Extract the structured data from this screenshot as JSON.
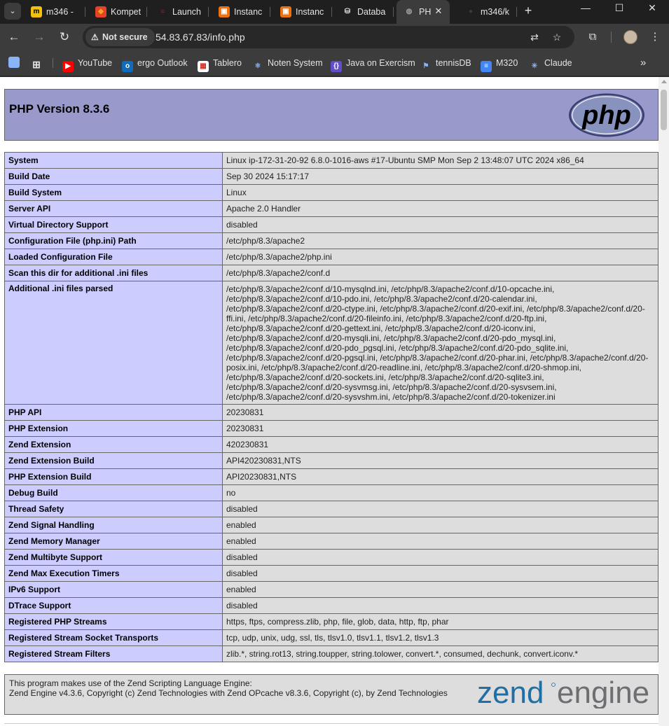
{
  "tabs": [
    {
      "label": "m346 -",
      "fav_color": "#f4c20d",
      "fav_text": "m",
      "fav_text_color": "#000"
    },
    {
      "label": "Kompet",
      "fav_color": "#e24329",
      "fav_text": "◆",
      "fav_text_color": "#fca326"
    },
    {
      "label": "Launch",
      "fav_color": "#1f1f1f",
      "fav_text": "○",
      "fav_text_color": "#e03030"
    },
    {
      "label": "Instanc",
      "fav_color": "#ec7211",
      "fav_text": "▣",
      "fav_text_color": "#fff"
    },
    {
      "label": "Instanc",
      "fav_color": "#ec7211",
      "fav_text": "▣",
      "fav_text_color": "#fff"
    },
    {
      "label": "Databa",
      "fav_color": "#1f1f1f",
      "fav_text": "⛁",
      "fav_text_color": "#e3e3e3"
    },
    {
      "label": "PH",
      "fav_color": "#3c3c3c",
      "fav_text": "◍",
      "fav_text_color": "#9aa0a6",
      "active": true
    },
    {
      "label": "m346/k",
      "fav_color": "#1f1f1f",
      "fav_text": "●",
      "fav_text_color": "#3a3a3a"
    }
  ],
  "window_controls": {
    "minimize": "—",
    "maximize": "☐",
    "close": "✕"
  },
  "toolbar": {
    "security_label": "Not secure",
    "url": "54.83.67.83/info.php"
  },
  "bookmarks": [
    {
      "label": "YouTube",
      "fav_color": "#ff0000",
      "fav_text": "▶"
    },
    {
      "label": "ergo Outlook",
      "fav_color": "#0f6cbd",
      "fav_text": "o"
    },
    {
      "label": "Tablero",
      "fav_color": "#ffffff",
      "fav_text": "▦"
    },
    {
      "label": "Noten System",
      "fav_color": "#3c3c3c",
      "fav_text": "⚛"
    },
    {
      "label": "Java on Exercism",
      "fav_color": "#604fcd",
      "fav_text": "{}"
    },
    {
      "label": "tennisDB",
      "fav_color": "#3c3c3c",
      "fav_text": "⚑"
    },
    {
      "label": "M320",
      "fav_color": "#4285f4",
      "fav_text": "≡"
    },
    {
      "label": "Claude",
      "fav_color": "#3c3c3c",
      "fav_text": "✳"
    }
  ],
  "page": {
    "title": "PHP Version 8.3.6",
    "logo_text": "php",
    "rows": [
      {
        "key": "System",
        "value": "Linux ip-172-31-20-92 6.8.0-1016-aws #17-Ubuntu SMP Mon Sep 2 13:48:07 UTC 2024 x86_64"
      },
      {
        "key": "Build Date",
        "value": "Sep 30 2024 15:17:17"
      },
      {
        "key": "Build System",
        "value": "Linux"
      },
      {
        "key": "Server API",
        "value": "Apache 2.0 Handler"
      },
      {
        "key": "Virtual Directory Support",
        "value": "disabled"
      },
      {
        "key": "Configuration File (php.ini) Path",
        "value": "/etc/php/8.3/apache2"
      },
      {
        "key": "Loaded Configuration File",
        "value": "/etc/php/8.3/apache2/php.ini"
      },
      {
        "key": "Scan this dir for additional .ini files",
        "value": "/etc/php/8.3/apache2/conf.d"
      },
      {
        "key": "Additional .ini files parsed",
        "value": "/etc/php/8.3/apache2/conf.d/10-mysqlnd.ini, /etc/php/8.3/apache2/conf.d/10-opcache.ini,\n/etc/php/8.3/apache2/conf.d/10-pdo.ini, /etc/php/8.3/apache2/conf.d/20-calendar.ini,\n/etc/php/8.3/apache2/conf.d/20-ctype.ini, /etc/php/8.3/apache2/conf.d/20-exif.ini, /etc/php/8.3/apache2/conf.d/20-\nffi.ini, /etc/php/8.3/apache2/conf.d/20-fileinfo.ini, /etc/php/8.3/apache2/conf.d/20-ftp.ini,\n/etc/php/8.3/apache2/conf.d/20-gettext.ini, /etc/php/8.3/apache2/conf.d/20-iconv.ini,\n/etc/php/8.3/apache2/conf.d/20-mysqli.ini, /etc/php/8.3/apache2/conf.d/20-pdo_mysql.ini,\n/etc/php/8.3/apache2/conf.d/20-pdo_pgsql.ini, /etc/php/8.3/apache2/conf.d/20-pdo_sqlite.ini,\n/etc/php/8.3/apache2/conf.d/20-pgsql.ini, /etc/php/8.3/apache2/conf.d/20-phar.ini, /etc/php/8.3/apache2/conf.d/20-\nposix.ini, /etc/php/8.3/apache2/conf.d/20-readline.ini, /etc/php/8.3/apache2/conf.d/20-shmop.ini,\n/etc/php/8.3/apache2/conf.d/20-sockets.ini, /etc/php/8.3/apache2/conf.d/20-sqlite3.ini,\n/etc/php/8.3/apache2/conf.d/20-sysvmsg.ini, /etc/php/8.3/apache2/conf.d/20-sysvsem.ini,\n/etc/php/8.3/apache2/conf.d/20-sysvshm.ini, /etc/php/8.3/apache2/conf.d/20-tokenizer.ini"
      },
      {
        "key": "PHP API",
        "value": "20230831"
      },
      {
        "key": "PHP Extension",
        "value": "20230831"
      },
      {
        "key": "Zend Extension",
        "value": "420230831"
      },
      {
        "key": "Zend Extension Build",
        "value": "API420230831,NTS"
      },
      {
        "key": "PHP Extension Build",
        "value": "API20230831,NTS"
      },
      {
        "key": "Debug Build",
        "value": "no"
      },
      {
        "key": "Thread Safety",
        "value": "disabled"
      },
      {
        "key": "Zend Signal Handling",
        "value": "enabled"
      },
      {
        "key": "Zend Memory Manager",
        "value": "enabled"
      },
      {
        "key": "Zend Multibyte Support",
        "value": "disabled"
      },
      {
        "key": "Zend Max Execution Timers",
        "value": "disabled"
      },
      {
        "key": "IPv6 Support",
        "value": "enabled"
      },
      {
        "key": "DTrace Support",
        "value": "disabled"
      },
      {
        "key": "Registered PHP Streams",
        "value": "https, ftps, compress.zlib, php, file, glob, data, http, ftp, phar"
      },
      {
        "key": "Registered Stream Socket Transports",
        "value": "tcp, udp, unix, udg, ssl, tls, tlsv1.0, tlsv1.1, tlsv1.2, tlsv1.3"
      },
      {
        "key": "Registered Stream Filters",
        "value": "zlib.*, string.rot13, string.toupper, string.tolower, convert.*, consumed, dechunk, convert.iconv.*"
      }
    ],
    "zend": {
      "line1": "This program makes use of the Zend Scripting Language Engine:",
      "line2": "Zend Engine v4.3.6, Copyright (c) Zend Technologies with Zend OPcache v8.3.6, Copyright (c), by Zend Technologies",
      "logo_word1": "zend",
      "logo_word2": "engine"
    }
  }
}
